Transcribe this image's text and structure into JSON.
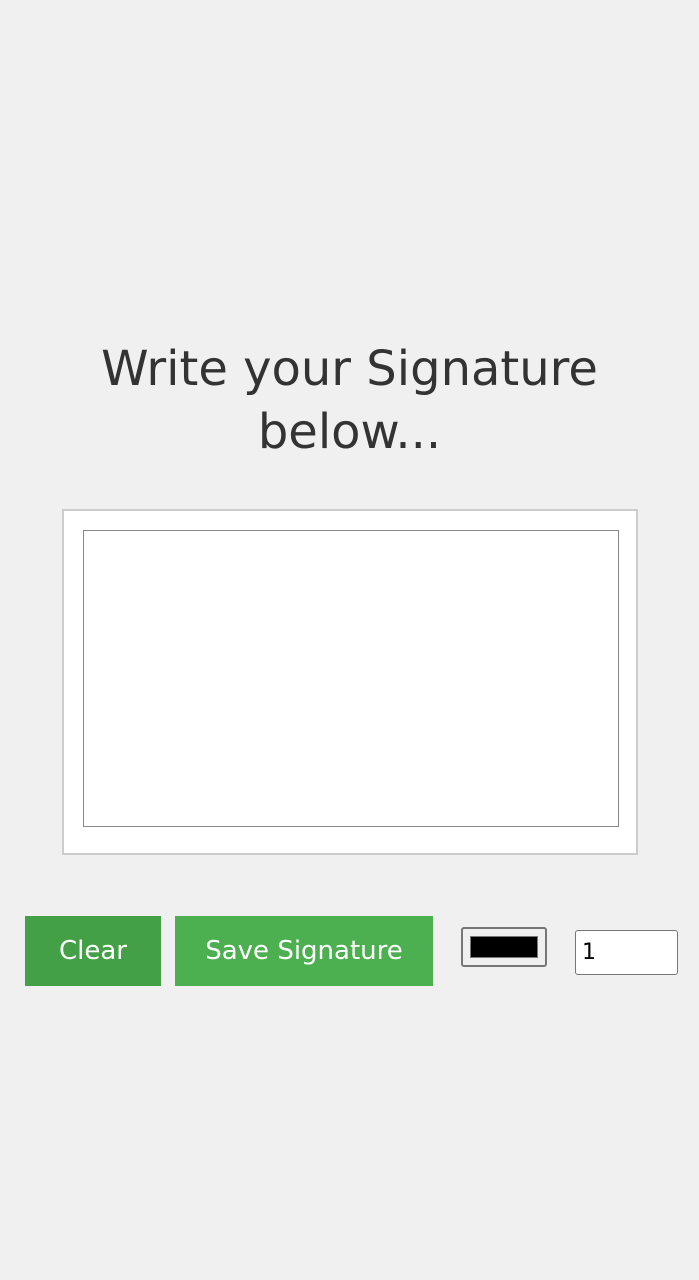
{
  "heading": {
    "line1": "Write your Signature",
    "line2": "below..."
  },
  "buttons": {
    "clear_label": "Clear",
    "save_label": "Save Signature"
  },
  "pen": {
    "color": "#000000",
    "width": "1"
  },
  "theme": {
    "clear_button_bg": "#43a047",
    "save_button_bg": "#4caf50",
    "page_bg": "#f0f0f0",
    "heading_color": "#333333"
  }
}
